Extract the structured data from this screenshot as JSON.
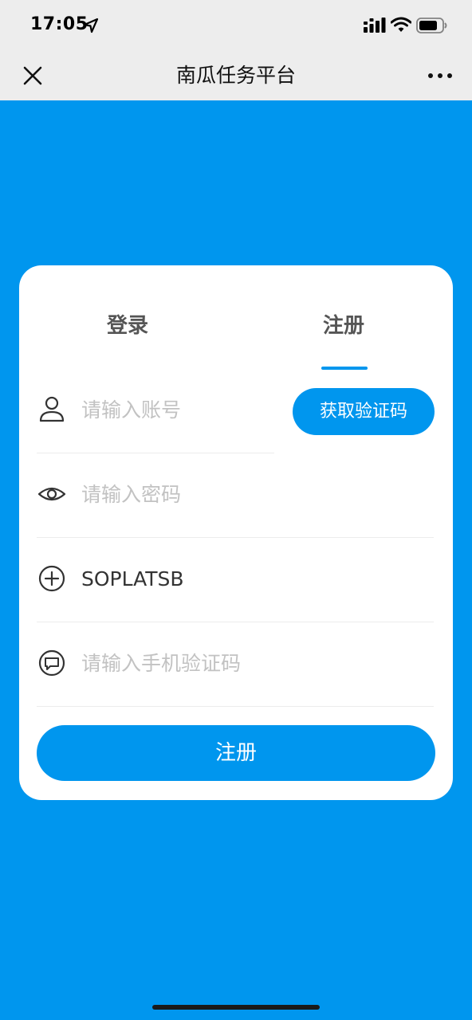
{
  "status_bar": {
    "time": "17:05"
  },
  "nav": {
    "title": "南瓜任务平台"
  },
  "tabs": [
    {
      "label": "登录",
      "active": false
    },
    {
      "label": "注册",
      "active": true
    }
  ],
  "form": {
    "account": {
      "placeholder": "请输入账号",
      "value": ""
    },
    "get_code_label": "获取验证码",
    "password": {
      "placeholder": "请输入密码",
      "value": ""
    },
    "invite_code": {
      "placeholder": "",
      "value": "SOPLATSB"
    },
    "sms_code": {
      "placeholder": "请输入手机验证码",
      "value": ""
    },
    "submit_label": "注册"
  },
  "colors": {
    "accent": "#0096ee",
    "background": "#0096ee",
    "nav_background": "#ededed",
    "placeholder": "#c2c2c2"
  },
  "icons": {
    "status": [
      "location-arrow-icon",
      "signal-icon",
      "wifi-icon",
      "battery-icon"
    ],
    "nav": [
      "close-icon",
      "more-icon"
    ],
    "fields": [
      "user-icon",
      "eye-icon",
      "plus-circle-icon",
      "message-icon"
    ]
  }
}
